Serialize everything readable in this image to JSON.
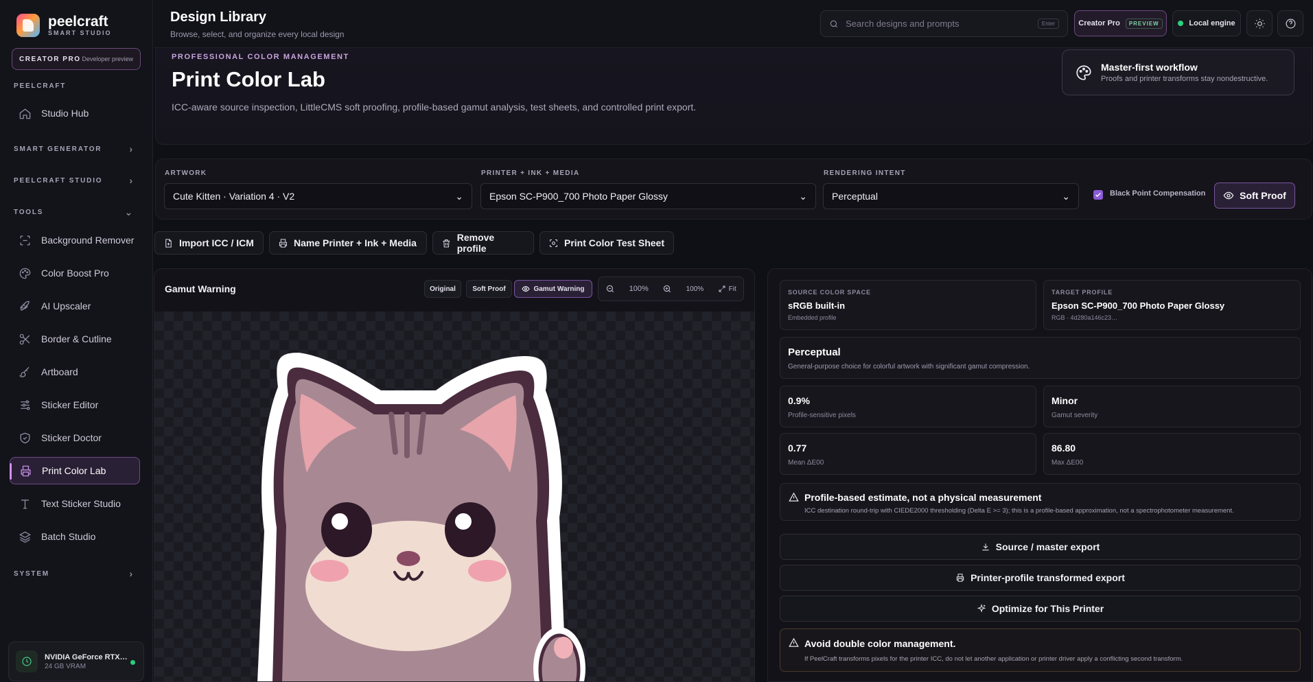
{
  "brand": {
    "name": "peelcraft",
    "subtitle": "SMART STUDIO"
  },
  "tier": {
    "label": "CREATOR PRO",
    "note": "Developer preview"
  },
  "sidebar": {
    "section_peelcraft": "PEELCRAFT",
    "studio_hub": "Studio Hub",
    "smart_generator": "SMART GENERATOR",
    "peelcraft_studio": "PEELCRAFT STUDIO",
    "tools": "TOOLS",
    "items": [
      {
        "label": "Background Remover",
        "icon": "scan-icon"
      },
      {
        "label": "Color Boost Pro",
        "icon": "palette-icon"
      },
      {
        "label": "AI Upscaler",
        "icon": "rocket-icon"
      },
      {
        "label": "Border & Cutline",
        "icon": "scissors-icon"
      },
      {
        "label": "Artboard",
        "icon": "brush-icon"
      },
      {
        "label": "Sticker Editor",
        "icon": "sliders-icon"
      },
      {
        "label": "Sticker Doctor",
        "icon": "shield-icon"
      },
      {
        "label": "Print Color Lab",
        "icon": "printer-icon"
      },
      {
        "label": "Text Sticker Studio",
        "icon": "text-icon"
      },
      {
        "label": "Batch Studio",
        "icon": "layers-icon"
      }
    ],
    "system": "SYSTEM",
    "active_color": "#d58dff"
  },
  "gpu": {
    "name": "NVIDIA GeForce RTX…",
    "vram": "24 GB VRAM",
    "status_color": "#28d07a"
  },
  "topbar": {
    "title": "Design Library",
    "subtitle": "Browse, select, and organize every local design",
    "search_placeholder": "Search designs and prompts",
    "search_key": "Enter",
    "plan": "Creator Pro",
    "plan_badge": "PREVIEW",
    "engine": "Local engine"
  },
  "hero": {
    "eyebrow": "PROFESSIONAL COLOR MANAGEMENT",
    "title": "Print Color Lab",
    "description": "ICC-aware source inspection, LittleCMS soft proofing, profile-based gamut analysis, test sheets, and controlled print export.",
    "callout_title": "Master-first workflow",
    "callout_text": "Proofs and printer transforms stay nondestructive."
  },
  "controls": {
    "artwork_label": "ARTWORK",
    "artwork_value": "Cute Kitten · Variation 4 · V2",
    "printer_label": "PRINTER + INK + MEDIA",
    "printer_value": "Epson SC-P900_700 Photo Paper Glossy",
    "intent_label": "RENDERING INTENT",
    "intent_value": "Perceptual",
    "bpc_label": "Black Point Compensation",
    "bpc_checked": true,
    "soft_proof": "Soft Proof"
  },
  "actions": {
    "import": "Import ICC / ICM",
    "name_printer": "Name Printer + Ink + Media",
    "remove": "Remove profile",
    "test_sheet": "Print Color Test Sheet"
  },
  "canvas": {
    "title": "Gamut Warning",
    "modes": [
      "Original",
      "Soft Proof",
      "Gamut Warning"
    ],
    "active_mode": "Gamut Warning",
    "zoom_a": "100%",
    "zoom_b": "100%",
    "fit": "Fit"
  },
  "analysis": {
    "source_label": "SOURCE COLOR SPACE",
    "source_value": "sRGB built-in",
    "source_sub": "Embedded profile",
    "target_label": "TARGET PROFILE",
    "target_value": "Epson SC-P900_700 Photo Paper Glossy",
    "target_sub": "RGB · 4d280a146c23…",
    "intent_title": "Perceptual",
    "intent_desc": "General-purpose choice for colorful artwork with significant gamut compression.",
    "metrics": [
      {
        "value": "0.9%",
        "label": "Profile-sensitive pixels"
      },
      {
        "value": "Minor",
        "label": "Gamut severity"
      },
      {
        "value": "0.77",
        "label": "Mean ΔE00"
      },
      {
        "value": "86.80",
        "label": "Max ΔE00"
      }
    ],
    "note_title": "Profile-based estimate, not a physical measurement",
    "note_text": "ICC destination round-trip with CIEDE2000 thresholding (Delta E >= 3); this is a profile-based approximation, not a spectrophotometer measurement.",
    "export_master": "Source / master export",
    "export_printer": "Printer-profile transformed export",
    "optimize": "Optimize for This Printer",
    "warn_title": "Avoid double color management.",
    "warn_text": "If PeelCraft transforms pixels for the printer ICC, do not let another application or printer driver apply a conflicting second transform."
  }
}
